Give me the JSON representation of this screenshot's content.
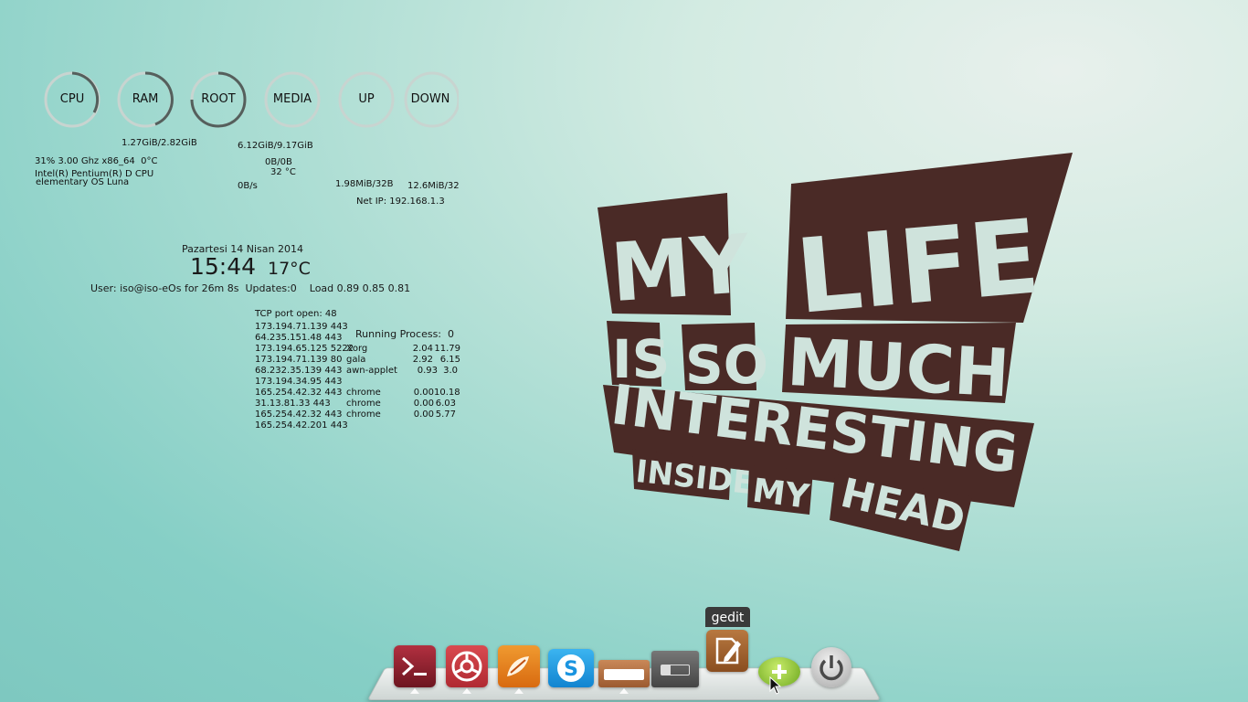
{
  "conky": {
    "gauges": [
      {
        "label": "CPU",
        "fill": 0.31
      },
      {
        "label": "RAM",
        "fill": 0.45
      },
      {
        "label": "ROOT",
        "fill": 0.67
      },
      {
        "label": "MEDIA",
        "fill": 0.0
      },
      {
        "label": "UP",
        "fill": 0.0
      },
      {
        "label": "DOWN",
        "fill": 0.0
      }
    ],
    "ram_usage": "1.27GiB/2.82GiB",
    "root_usage": "6.12GiB/9.17GiB",
    "media_usage": "0B/0B",
    "media_rate": "0B/s",
    "temp": "32 °C",
    "cpu_line": "31% 3.00 Ghz x86_64  0°C",
    "cpu_model": "Intel(R) Pentium(R) D CPU",
    "os_name": "elementary OS Luna",
    "up_total": "1.98MiB/32B",
    "down_total": "12.6MiB/32B",
    "net_ip": "Net IP: 192.168.1.3",
    "date": "Pazartesi 14 Nisan 2014",
    "time": "15:44",
    "weather": "17°C",
    "status_line": "User: iso@iso-eOs for 26m 8s  Updates:0    Load 0.89 0.85 0.81",
    "tcp_header": "TCP port open: 48",
    "tcp_ports": [
      "173.194.71.139 443",
      "64.235.151.48 443",
      "173.194.65.125 5222",
      "173.194.71.139 80",
      "68.232.35.139 443",
      "173.194.34.95 443",
      "165.254.42.32 443",
      "31.13.81.33 443",
      "165.254.42.32 443",
      "165.254.42.201 443"
    ],
    "running_header": "Running Process:  0",
    "processes": [
      {
        "name": "Xorg",
        "cpu": "2.04",
        "mem": "11.79"
      },
      {
        "name": "gala",
        "cpu": "2.92",
        "mem": "6.15"
      },
      {
        "name": "awn-applet",
        "cpu": "0.93",
        "mem": "3.0"
      },
      {
        "name": "chrome",
        "cpu": "0.00",
        "mem": "10.18"
      },
      {
        "name": "chrome",
        "cpu": "0.00",
        "mem": "6.03"
      },
      {
        "name": "chrome",
        "cpu": "0.00",
        "mem": "5.77"
      }
    ]
  },
  "poster": {
    "line1a": "MY",
    "line1b": "LIFE",
    "line2a": "IS",
    "line2b": "SO",
    "line2c": "MUCH",
    "line3": "INTERESTING",
    "line4a": "INSIDE",
    "line4b": "MY",
    "line4c": "HEAD"
  },
  "dock": {
    "tooltip": "gedit",
    "icons": [
      {
        "name": "terminal",
        "color": "#8b1e2a"
      },
      {
        "name": "chromium",
        "color": "#c8303a"
      },
      {
        "name": "shotwell",
        "color": "#e37a1a"
      },
      {
        "name": "skype",
        "color": "#1aa0e0"
      },
      {
        "name": "files",
        "color": "#b86f45"
      },
      {
        "name": "switchboard",
        "color": "#555"
      },
      {
        "name": "gedit",
        "color": "#9a5a2a"
      },
      {
        "name": "add",
        "color": "#8fc43b"
      },
      {
        "name": "power",
        "color": "#6a6a6a"
      }
    ]
  },
  "colors": {
    "poster": "#4a2a26",
    "poster_text": "#cfe3dc",
    "gauge_ring": "#c8d4d0",
    "gauge_fill": "#555f5c"
  }
}
